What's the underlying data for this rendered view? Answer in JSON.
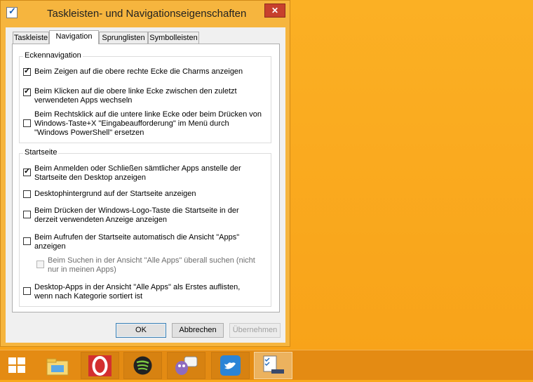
{
  "window": {
    "title": "Taskleisten- und Navigationseigenschaften",
    "close_label": "✕"
  },
  "tabs": [
    "Taskleiste",
    "Navigation",
    "Sprunglisten",
    "Symbolleisten"
  ],
  "active_tab": "Navigation",
  "corner_navigation": {
    "title": "Eckennavigation",
    "options": [
      {
        "lines": [
          "Beim Zeigen auf die obere rechte Ecke die Charms anzeigen"
        ],
        "checked": true
      },
      {
        "lines": [
          "Beim Klicken auf die obere linke Ecke zwischen den zuletzt",
          "verwendeten Apps wechseln"
        ],
        "checked": true
      },
      {
        "lines": [
          "Beim Rechtsklick auf die untere linke Ecke oder beim Drücken von",
          "Windows-Taste+X \"Eingabeaufforderung\" im Menü durch",
          "\"Windows PowerShell\" ersetzen"
        ],
        "checked": false
      }
    ]
  },
  "start_screen": {
    "title": "Startseite",
    "options": [
      {
        "lines": [
          "Beim Anmelden oder Schließen sämtlicher Apps anstelle der",
          "Startseite den Desktop anzeigen"
        ],
        "checked": true
      },
      {
        "lines": [
          "Desktophintergrund auf der Startseite anzeigen"
        ],
        "checked": false
      },
      {
        "lines": [
          "Beim Drücken der Windows-Logo-Taste die Startseite in der",
          "derzeit verwendeten Anzeige anzeigen"
        ],
        "checked": false
      },
      {
        "lines": [
          "Beim Aufrufen der Startseite automatisch die Ansicht \"Apps\"",
          "anzeigen"
        ],
        "checked": false
      },
      {
        "lines": [
          "Beim Suchen in der Ansicht \"Alle Apps\" überall suchen (nicht",
          "nur in meinen Apps)"
        ],
        "checked": false,
        "disabled": true
      },
      {
        "lines": [
          "Desktop-Apps in der Ansicht \"Alle Apps\" als Erstes auflisten,",
          "wenn nach Kategorie sortiert ist"
        ],
        "checked": false
      }
    ]
  },
  "buttons": {
    "ok": "OK",
    "cancel": "Abbrechen",
    "apply": "Übernehmen"
  },
  "taskbar": {
    "items": [
      "start-icon",
      "file-explorer-icon",
      "opera-icon",
      "spotify-icon",
      "pidgin-icon",
      "twitter-icon",
      "taskbar-properties-icon"
    ]
  }
}
